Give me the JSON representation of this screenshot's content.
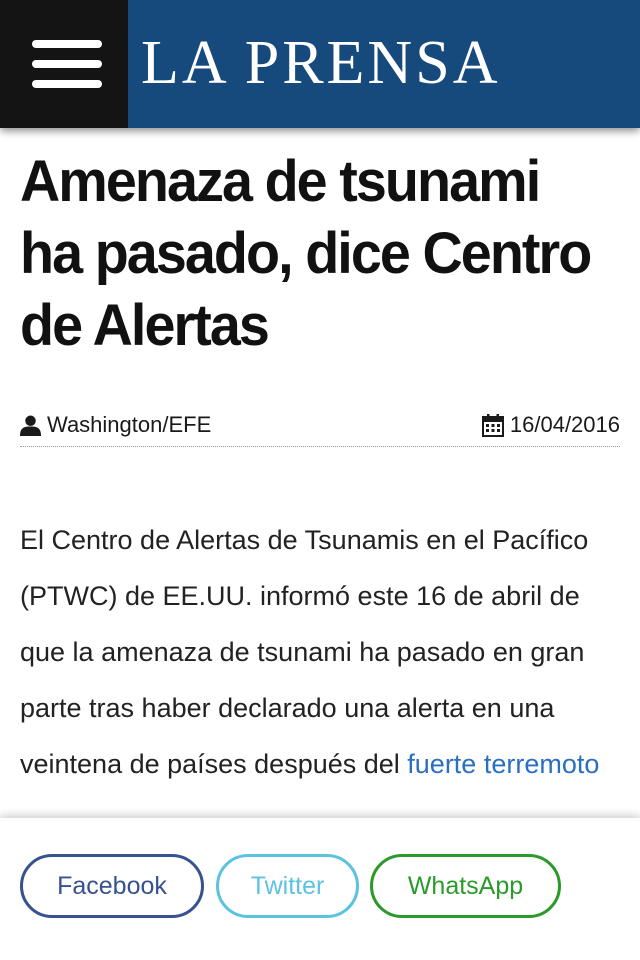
{
  "header": {
    "logo_text": "LA PRENSA"
  },
  "article": {
    "title": "Amenaza de tsunami ha pasado, dice Centro de Alertas",
    "author": "Washington/EFE",
    "date": "16/04/2016",
    "body_text": "El Centro de Alertas de Tsunamis en el Pacífico (PTWC) de EE.UU. informó este 16 de abril de que la amenaza de tsunami ha pasado en gran parte tras haber declarado una alerta en una veintena de países después del ",
    "body_link": "fuerte terremoto"
  },
  "share": {
    "facebook_label": "Facebook",
    "twitter_label": "Twitter",
    "whatsapp_label": "WhatsApp"
  },
  "colors": {
    "header_bg": "#174a7c",
    "menu_bg": "#141414",
    "link": "#2a6fc0",
    "facebook": "#36528f",
    "twitter": "#5bc3df",
    "whatsapp": "#2a9b2a"
  },
  "icons": {
    "menu": "hamburger-menu-icon",
    "author": "user-icon",
    "date": "calendar-icon"
  }
}
